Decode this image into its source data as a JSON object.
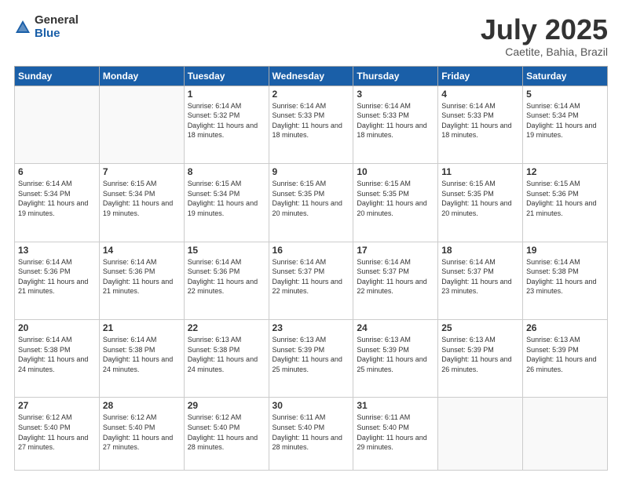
{
  "logo": {
    "general": "General",
    "blue": "Blue"
  },
  "title": "July 2025",
  "subtitle": "Caetite, Bahia, Brazil",
  "days_header": [
    "Sunday",
    "Monday",
    "Tuesday",
    "Wednesday",
    "Thursday",
    "Friday",
    "Saturday"
  ],
  "weeks": [
    [
      {
        "day": "",
        "info": ""
      },
      {
        "day": "",
        "info": ""
      },
      {
        "day": "1",
        "info": "Sunrise: 6:14 AM\nSunset: 5:32 PM\nDaylight: 11 hours and 18 minutes."
      },
      {
        "day": "2",
        "info": "Sunrise: 6:14 AM\nSunset: 5:33 PM\nDaylight: 11 hours and 18 minutes."
      },
      {
        "day": "3",
        "info": "Sunrise: 6:14 AM\nSunset: 5:33 PM\nDaylight: 11 hours and 18 minutes."
      },
      {
        "day": "4",
        "info": "Sunrise: 6:14 AM\nSunset: 5:33 PM\nDaylight: 11 hours and 18 minutes."
      },
      {
        "day": "5",
        "info": "Sunrise: 6:14 AM\nSunset: 5:34 PM\nDaylight: 11 hours and 19 minutes."
      }
    ],
    [
      {
        "day": "6",
        "info": "Sunrise: 6:14 AM\nSunset: 5:34 PM\nDaylight: 11 hours and 19 minutes."
      },
      {
        "day": "7",
        "info": "Sunrise: 6:15 AM\nSunset: 5:34 PM\nDaylight: 11 hours and 19 minutes."
      },
      {
        "day": "8",
        "info": "Sunrise: 6:15 AM\nSunset: 5:34 PM\nDaylight: 11 hours and 19 minutes."
      },
      {
        "day": "9",
        "info": "Sunrise: 6:15 AM\nSunset: 5:35 PM\nDaylight: 11 hours and 20 minutes."
      },
      {
        "day": "10",
        "info": "Sunrise: 6:15 AM\nSunset: 5:35 PM\nDaylight: 11 hours and 20 minutes."
      },
      {
        "day": "11",
        "info": "Sunrise: 6:15 AM\nSunset: 5:35 PM\nDaylight: 11 hours and 20 minutes."
      },
      {
        "day": "12",
        "info": "Sunrise: 6:15 AM\nSunset: 5:36 PM\nDaylight: 11 hours and 21 minutes."
      }
    ],
    [
      {
        "day": "13",
        "info": "Sunrise: 6:14 AM\nSunset: 5:36 PM\nDaylight: 11 hours and 21 minutes."
      },
      {
        "day": "14",
        "info": "Sunrise: 6:14 AM\nSunset: 5:36 PM\nDaylight: 11 hours and 21 minutes."
      },
      {
        "day": "15",
        "info": "Sunrise: 6:14 AM\nSunset: 5:36 PM\nDaylight: 11 hours and 22 minutes."
      },
      {
        "day": "16",
        "info": "Sunrise: 6:14 AM\nSunset: 5:37 PM\nDaylight: 11 hours and 22 minutes."
      },
      {
        "day": "17",
        "info": "Sunrise: 6:14 AM\nSunset: 5:37 PM\nDaylight: 11 hours and 22 minutes."
      },
      {
        "day": "18",
        "info": "Sunrise: 6:14 AM\nSunset: 5:37 PM\nDaylight: 11 hours and 23 minutes."
      },
      {
        "day": "19",
        "info": "Sunrise: 6:14 AM\nSunset: 5:38 PM\nDaylight: 11 hours and 23 minutes."
      }
    ],
    [
      {
        "day": "20",
        "info": "Sunrise: 6:14 AM\nSunset: 5:38 PM\nDaylight: 11 hours and 24 minutes."
      },
      {
        "day": "21",
        "info": "Sunrise: 6:14 AM\nSunset: 5:38 PM\nDaylight: 11 hours and 24 minutes."
      },
      {
        "day": "22",
        "info": "Sunrise: 6:13 AM\nSunset: 5:38 PM\nDaylight: 11 hours and 24 minutes."
      },
      {
        "day": "23",
        "info": "Sunrise: 6:13 AM\nSunset: 5:39 PM\nDaylight: 11 hours and 25 minutes."
      },
      {
        "day": "24",
        "info": "Sunrise: 6:13 AM\nSunset: 5:39 PM\nDaylight: 11 hours and 25 minutes."
      },
      {
        "day": "25",
        "info": "Sunrise: 6:13 AM\nSunset: 5:39 PM\nDaylight: 11 hours and 26 minutes."
      },
      {
        "day": "26",
        "info": "Sunrise: 6:13 AM\nSunset: 5:39 PM\nDaylight: 11 hours and 26 minutes."
      }
    ],
    [
      {
        "day": "27",
        "info": "Sunrise: 6:12 AM\nSunset: 5:40 PM\nDaylight: 11 hours and 27 minutes."
      },
      {
        "day": "28",
        "info": "Sunrise: 6:12 AM\nSunset: 5:40 PM\nDaylight: 11 hours and 27 minutes."
      },
      {
        "day": "29",
        "info": "Sunrise: 6:12 AM\nSunset: 5:40 PM\nDaylight: 11 hours and 28 minutes."
      },
      {
        "day": "30",
        "info": "Sunrise: 6:11 AM\nSunset: 5:40 PM\nDaylight: 11 hours and 28 minutes."
      },
      {
        "day": "31",
        "info": "Sunrise: 6:11 AM\nSunset: 5:40 PM\nDaylight: 11 hours and 29 minutes."
      },
      {
        "day": "",
        "info": ""
      },
      {
        "day": "",
        "info": ""
      }
    ]
  ]
}
